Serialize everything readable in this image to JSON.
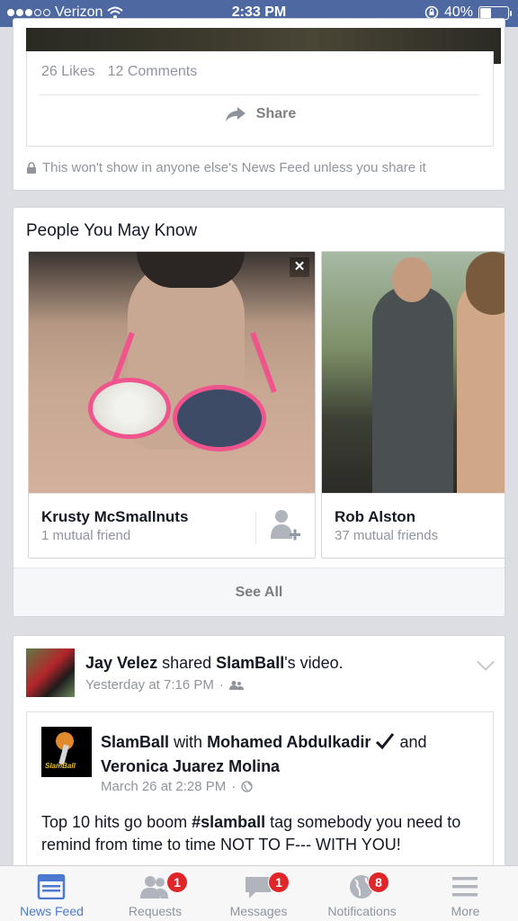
{
  "status_bar": {
    "carrier": "Verizon",
    "time": "2:33 PM",
    "battery": "40%",
    "battery_level": 0.4
  },
  "top_post": {
    "likes": "26 Likes",
    "comments": "12 Comments",
    "share_label": "Share",
    "privacy_note": "This won't show in anyone else's News Feed unless you share it"
  },
  "pymk": {
    "title": "People You May Know",
    "people": [
      {
        "name": "Krusty McSmallnuts",
        "mutual": "1 mutual friend"
      },
      {
        "name": "Rob Alston",
        "mutual": "37 mutual friends"
      }
    ],
    "see_all": "See All"
  },
  "post": {
    "author": "Jay Velez",
    "action": "shared",
    "page": "SlamBall",
    "object": "'s video.",
    "time": "Yesterday at 7:16 PM",
    "shared": {
      "logo_text": "SlamBall",
      "author": "SlamBall",
      "with_text": "with",
      "tagged1": "Mohamed Abdulkadir",
      "and_text": "and",
      "tagged2": "Veronica Juarez Molina",
      "time": "March 26 at 2:28 PM",
      "text_pre": "Top 10 hits go boom ",
      "hashtag": "#slamball",
      "text_post": " tag somebody you need to remind from time to time NOT TO F--- WITH YOU!"
    }
  },
  "tabbar": {
    "tabs": [
      {
        "label": "News Feed",
        "active": true
      },
      {
        "label": "Requests",
        "badge": "1"
      },
      {
        "label": "Messages",
        "badge": "1"
      },
      {
        "label": "Notifications",
        "badge": "8"
      },
      {
        "label": "More"
      }
    ]
  },
  "colors": {
    "brand": "#4e69a2",
    "active_tab": "#4b79d2",
    "badge": "#e1262a"
  }
}
